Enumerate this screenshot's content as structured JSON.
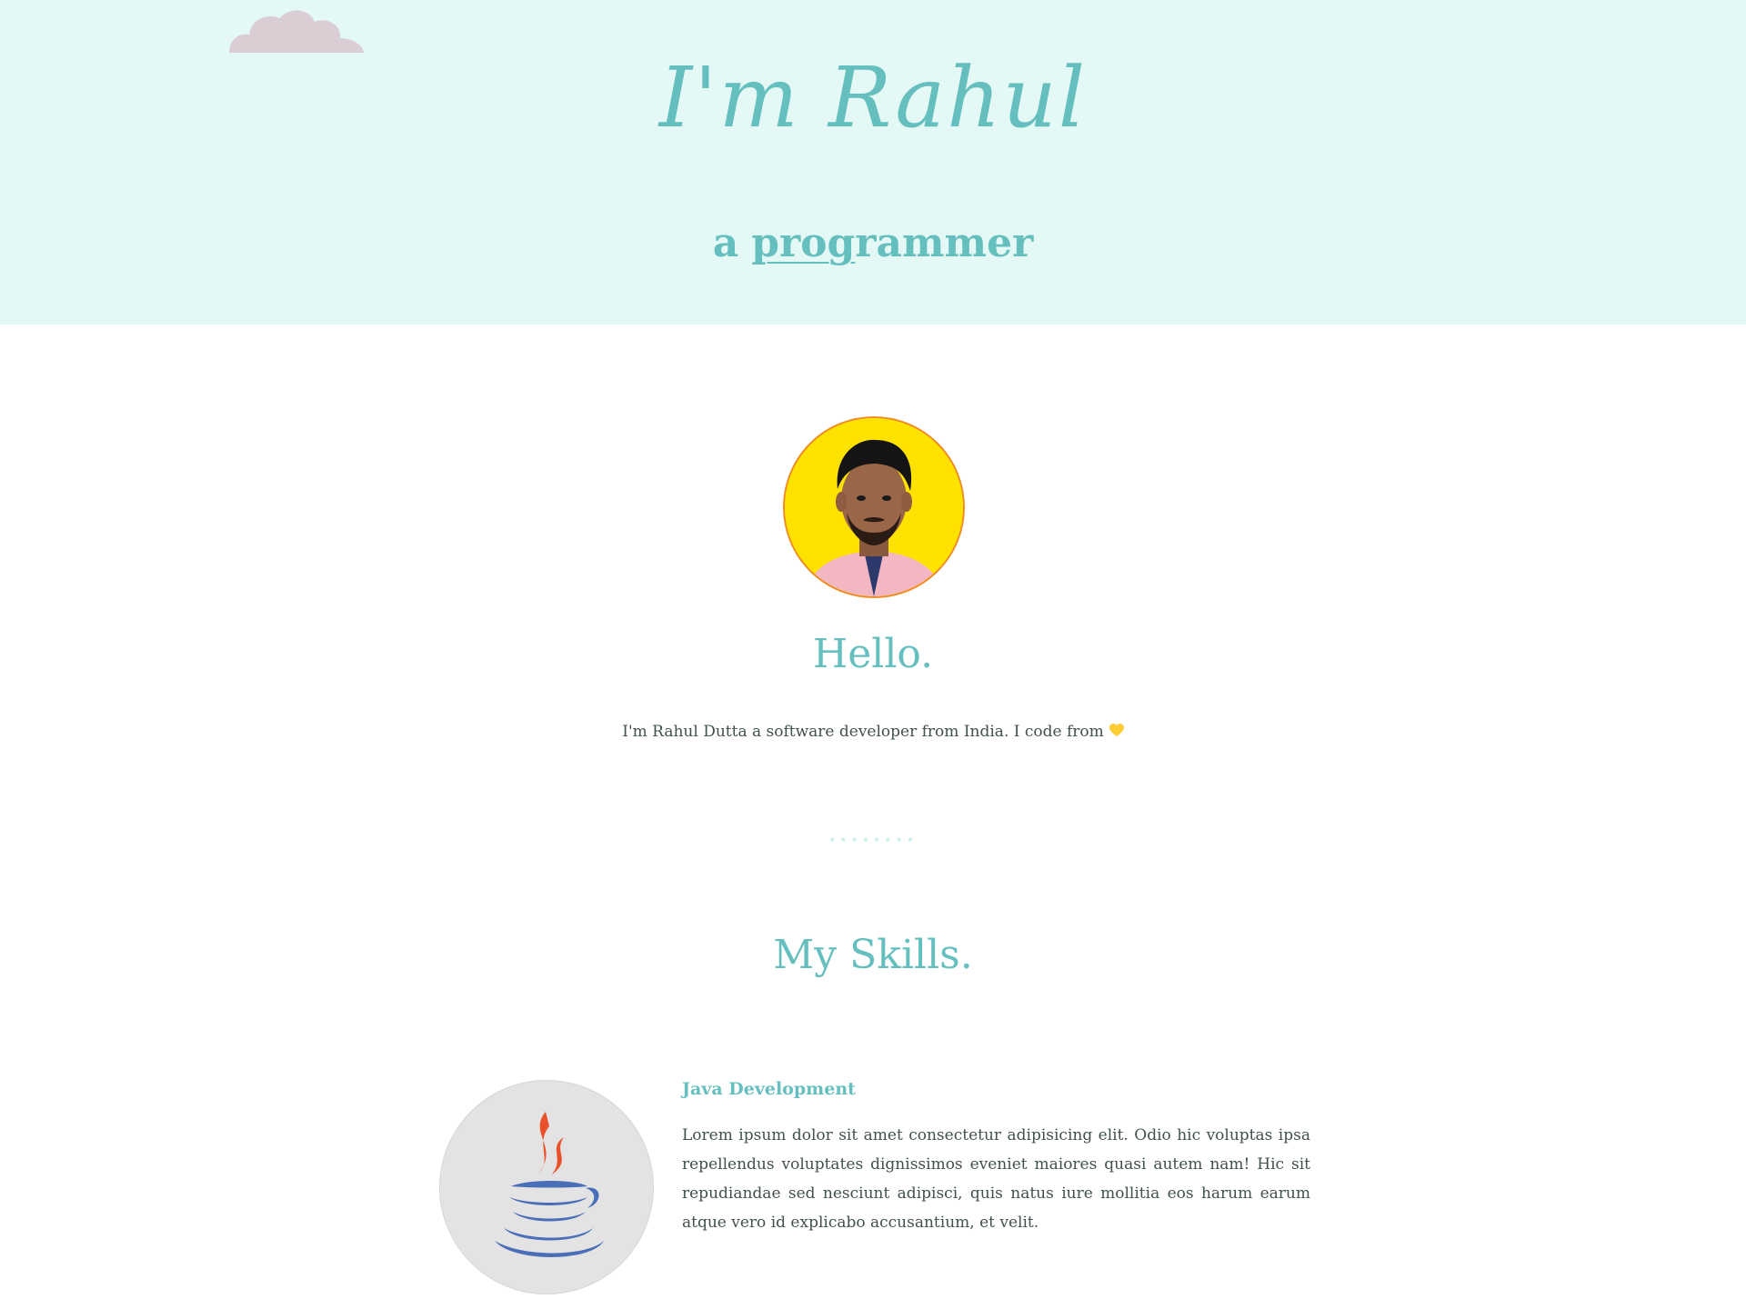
{
  "hero": {
    "title": "I'm Rahul",
    "subtitle_prefix": "a",
    "subtitle_underlined": "prog",
    "subtitle_rest": "rammer",
    "background": "#e4f9f5",
    "accent": "#66bfbf"
  },
  "about": {
    "hello": "Hello.",
    "intro": "I'm Rahul Dutta a software developer from India. I code from",
    "heart_icon": "yellow-heart-icon"
  },
  "divider": {
    "dots": "••••••••"
  },
  "skills": {
    "title": "My Skills.",
    "items": [
      {
        "heading": "Java Development",
        "icon": "java-logo-icon",
        "description": "Lorem ipsum dolor sit amet consectetur adipisicing elit. Odio hic voluptas ipsa repellendus voluptates dignissimos eveniet maiores quasi autem nam! Hic sit repudiandae sed nesciunt adipisci, quis natus iure mollitia eos harum earum atque vero id explicabo accusantium, et velit."
      }
    ]
  },
  "colors": {
    "text": "#40514e",
    "avatar_bg": "#ffe200",
    "avatar_border": "#f08a24",
    "java_red": "#e76f00",
    "java_blue": "#4a6fb8"
  }
}
